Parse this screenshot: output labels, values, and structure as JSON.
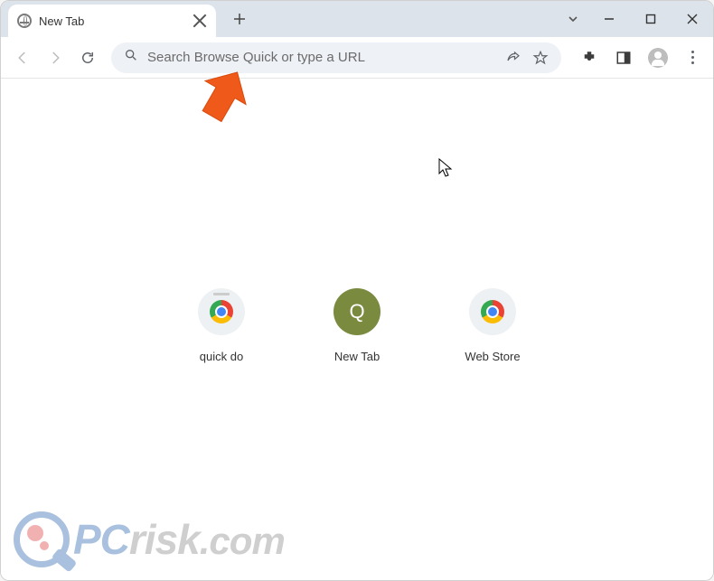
{
  "tab": {
    "title": "New Tab"
  },
  "omnibox": {
    "placeholder": "Search Browse Quick or type a URL"
  },
  "shortcuts": [
    {
      "label": "quick do",
      "kind": "chrome-bar"
    },
    {
      "label": "New Tab",
      "kind": "q"
    },
    {
      "label": "Web Store",
      "kind": "chrome"
    }
  ],
  "watermark": {
    "pc": "PC",
    "risk": "risk",
    "com": ".com"
  }
}
